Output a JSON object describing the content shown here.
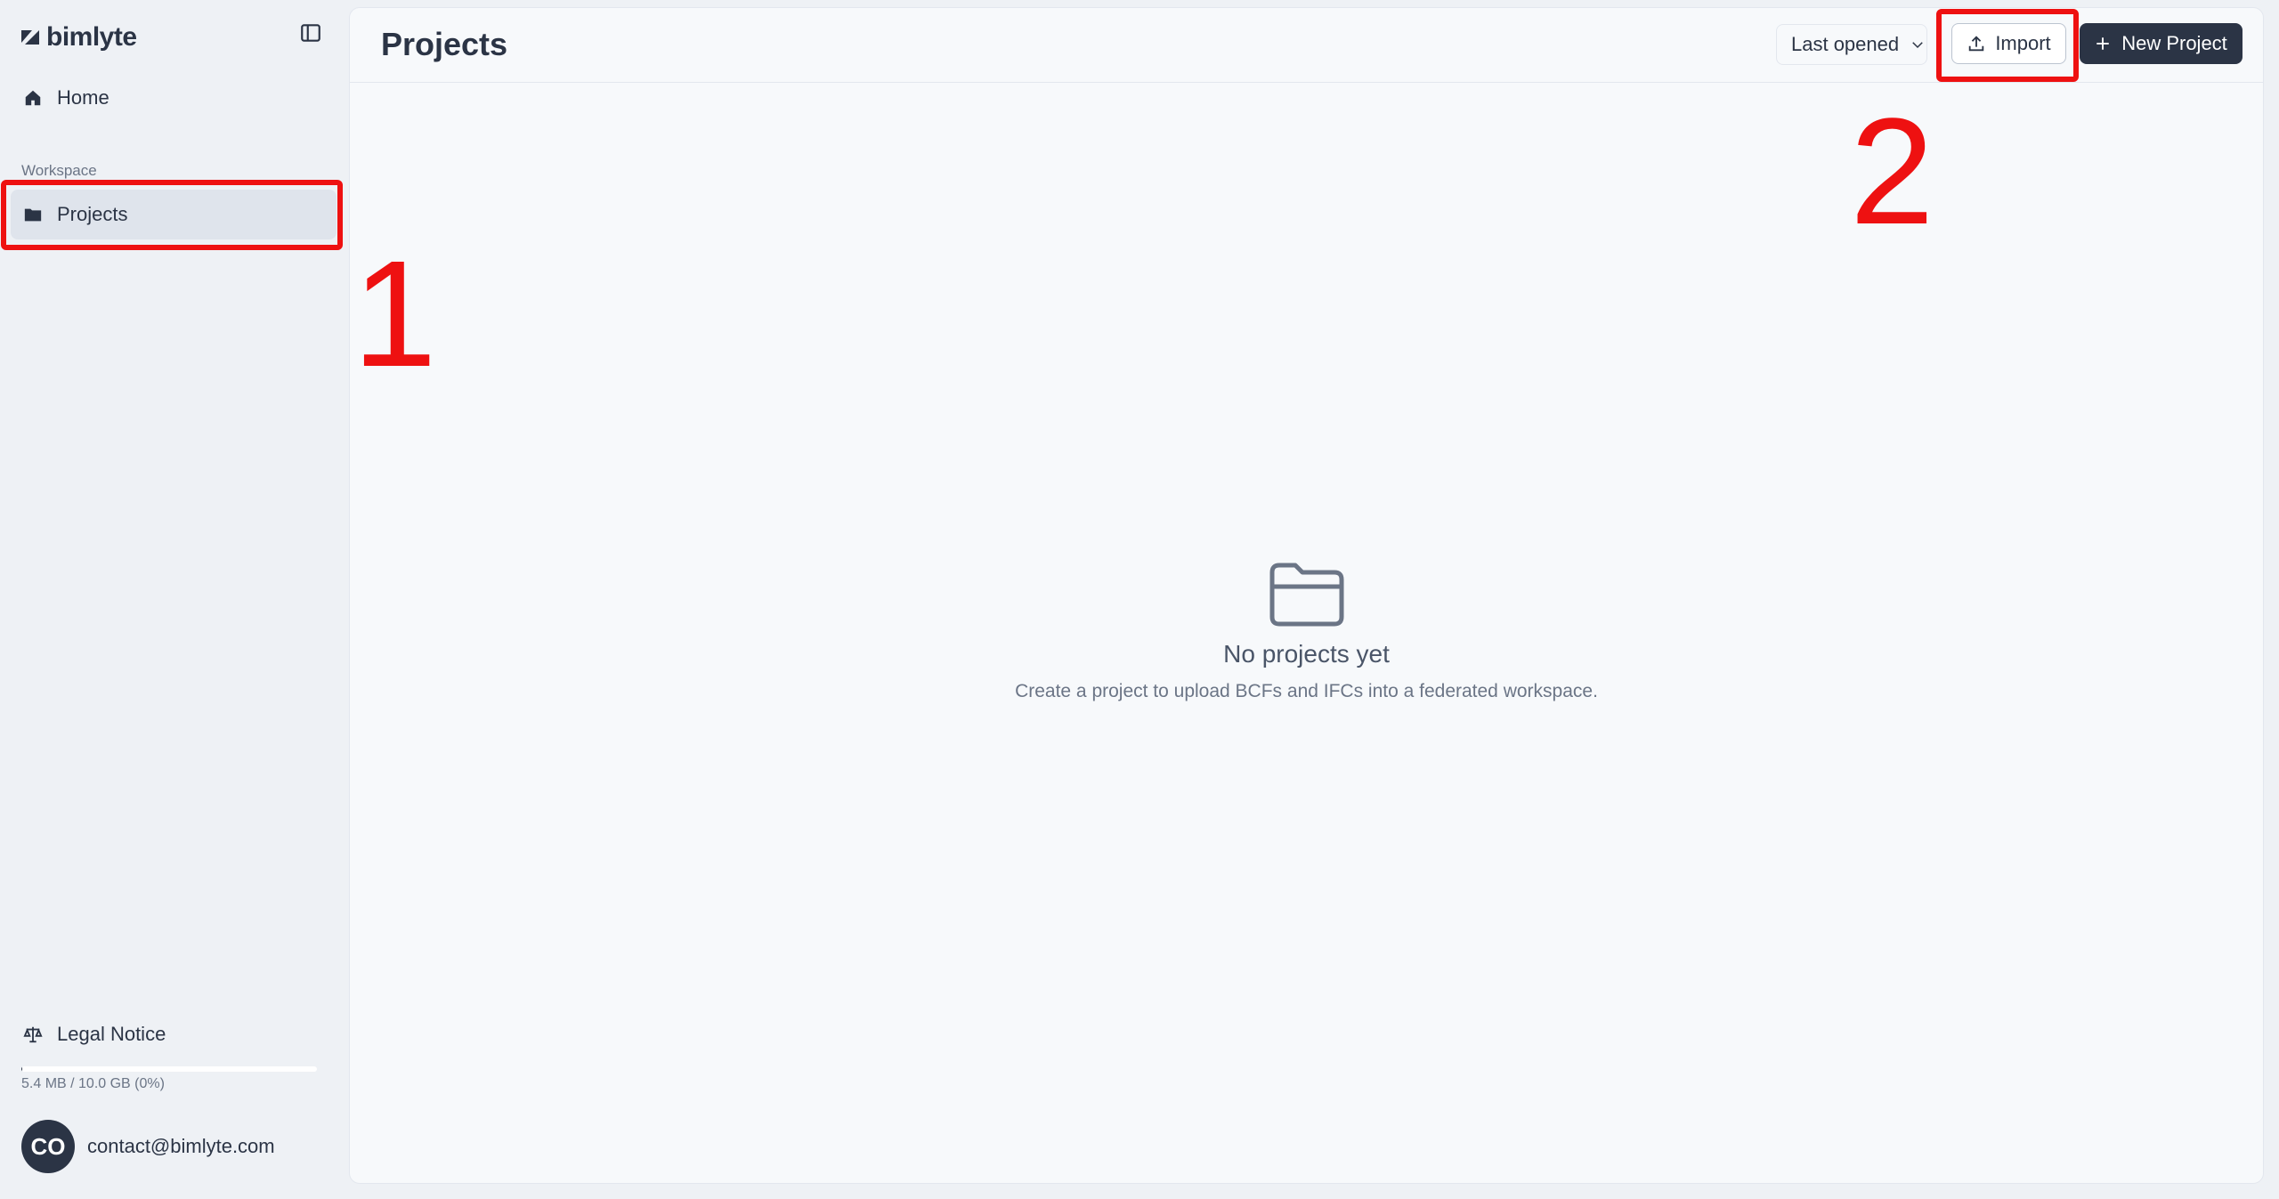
{
  "brand": {
    "name": "bimlyte"
  },
  "sidebar": {
    "home_label": "Home",
    "section_label": "Workspace",
    "projects_label": "Projects",
    "legal_label": "Legal Notice",
    "storage": {
      "text": "5.4 MB / 10.0 GB (0%)",
      "used_fraction": 0.0005
    },
    "user": {
      "initials": "CO",
      "email": "contact@bimlyte.com"
    }
  },
  "header": {
    "title": "Projects",
    "sort_value": "Last opened",
    "import_label": "Import",
    "new_project_label": "New Project"
  },
  "empty_state": {
    "title": "No projects yet",
    "subtitle": "Create a project to upload BCFs and IFCs into a federated workspace."
  },
  "annotations": {
    "one": "1",
    "two": "2"
  },
  "colors": {
    "primary": "#2b3445",
    "annotation": "#ee1111",
    "background": "#eef1f5"
  }
}
